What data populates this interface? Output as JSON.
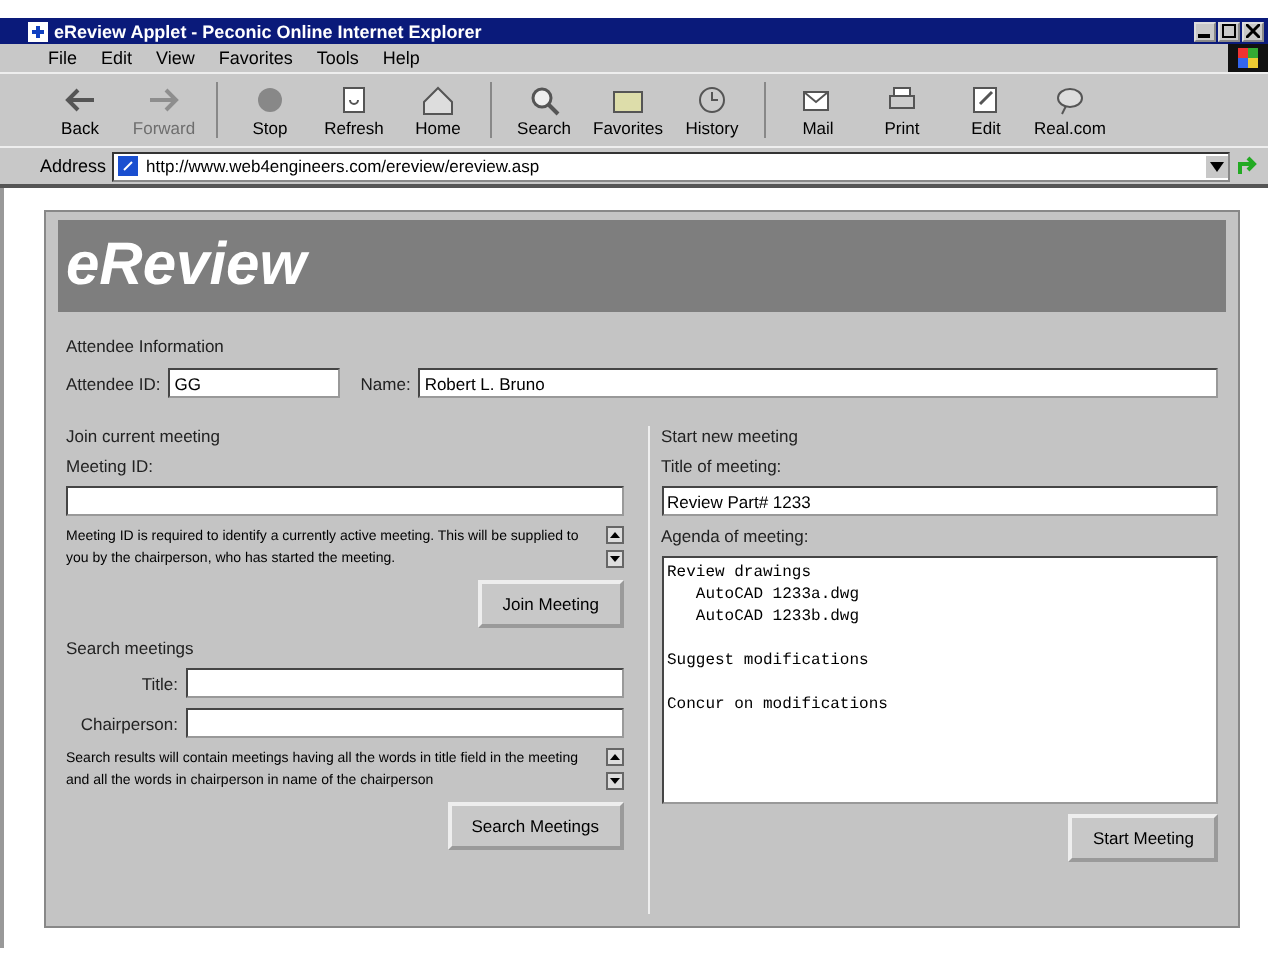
{
  "window": {
    "title": "eReview Applet - Peconic Online Internet Explorer"
  },
  "menu": [
    "File",
    "Edit",
    "View",
    "Favorites",
    "Tools",
    "Help"
  ],
  "toolbar": [
    {
      "label": "Back",
      "disabled": false
    },
    {
      "label": "Forward",
      "disabled": true
    },
    {
      "label": "Stop",
      "disabled": false
    },
    {
      "label": "Refresh",
      "disabled": false
    },
    {
      "label": "Home",
      "disabled": false
    },
    {
      "label": "Search",
      "disabled": false
    },
    {
      "label": "Favorites",
      "disabled": false
    },
    {
      "label": "History",
      "disabled": false
    },
    {
      "label": "Mail",
      "disabled": false
    },
    {
      "label": "Print",
      "disabled": false
    },
    {
      "label": "Edit",
      "disabled": false
    },
    {
      "label": "Real.com",
      "disabled": false
    }
  ],
  "address": {
    "label": "Address",
    "value": "http://www.web4engineers.com/ereview/ereview.asp"
  },
  "applet": {
    "logo": "eReview",
    "attendee": {
      "heading": "Attendee Information",
      "id_label": "Attendee ID:",
      "id_value": "GG",
      "name_label": "Name:",
      "name_value": "Robert L. Bruno"
    },
    "join": {
      "heading": "Join current meeting",
      "id_label": "Meeting ID:",
      "help": "Meeting ID is required to identify a currently active meeting. This will be supplied to you by the chairperson, who has started the meeting.",
      "button": "Join Meeting"
    },
    "search": {
      "heading": "Search meetings",
      "title_label": "Title:",
      "chair_label": "Chairperson:",
      "help": "Search results will contain meetings having all the words in title field in the meeting and all the words in chairperson in name of the chairperson",
      "button": "Search Meetings"
    },
    "start": {
      "heading": "Start new meeting",
      "title_label": "Title of meeting:",
      "title_value": "Review Part# 1233",
      "agenda_label": "Agenda of meeting:",
      "agenda": "Review drawings\n   AutoCAD 1233a.dwg\n   AutoCAD 1233b.dwg\n\nSuggest modifications\n\nConcur on modifications",
      "button": "Start Meeting"
    }
  }
}
